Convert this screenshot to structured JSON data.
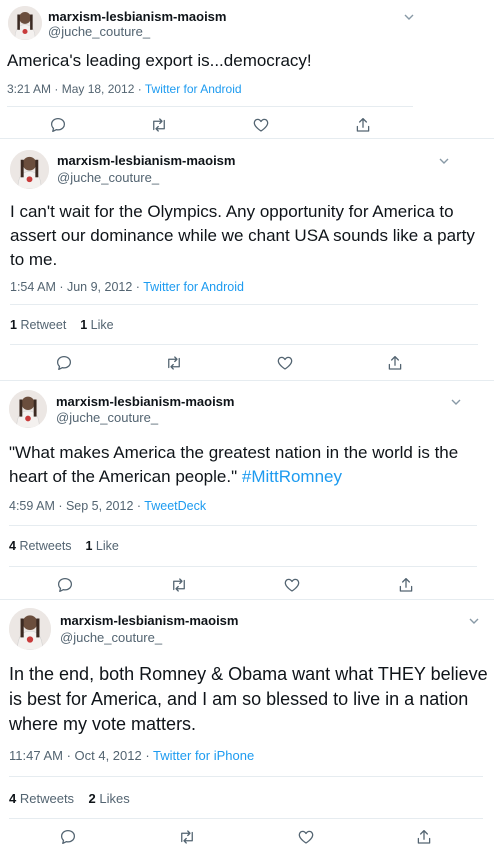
{
  "tweets": [
    {
      "name": "marxism-lesbianism-maoism",
      "handle": "@juche_couture_",
      "text": "America's leading export is...democracy!",
      "hashtag": "",
      "time": "3:21 AM · May 18, 2012 · ",
      "source": "Twitter for Android",
      "retweets_count": "",
      "retweets_label": "",
      "likes_count": "",
      "likes_label": ""
    },
    {
      "name": "marxism-lesbianism-maoism",
      "handle": "@juche_couture_",
      "text": "I can't wait for the Olympics. Any opportunity for America to assert our dominance while we chant USA sounds like a party to me.",
      "hashtag": "",
      "time": "1:54 AM · Jun 9, 2012 · ",
      "source": "Twitter for Android",
      "retweets_count": "1",
      "retweets_label": "Retweet",
      "likes_count": "1",
      "likes_label": "Like"
    },
    {
      "name": "marxism-lesbianism-maoism",
      "handle": "@juche_couture_",
      "text": "\"What makes America the greatest nation in the world is the heart of the American people.\" ",
      "hashtag": "#MittRomney",
      "time": "4:59 AM · Sep 5, 2012 · ",
      "source": "TweetDeck",
      "retweets_count": "4",
      "retweets_label": "Retweets",
      "likes_count": "1",
      "likes_label": "Like"
    },
    {
      "name": "marxism-lesbianism-maoism",
      "handle": "@juche_couture_",
      "text": "In the end, both Romney & Obama want what THEY believe is best for America, and I am so blessed to live in a nation where my vote matters.",
      "hashtag": "",
      "time": "11:47 AM · Oct 4, 2012 · ",
      "source": "Twitter for iPhone",
      "retweets_count": "4",
      "retweets_label": "Retweets",
      "likes_count": "2",
      "likes_label": "Likes"
    }
  ],
  "icons": {
    "reply": "reply-icon",
    "retweet": "retweet-icon",
    "like": "heart-icon",
    "share": "share-icon",
    "more": "chevron-down-icon"
  },
  "colors": {
    "link": "#1d9bf0",
    "muted": "#536471",
    "text": "#0f1419"
  }
}
